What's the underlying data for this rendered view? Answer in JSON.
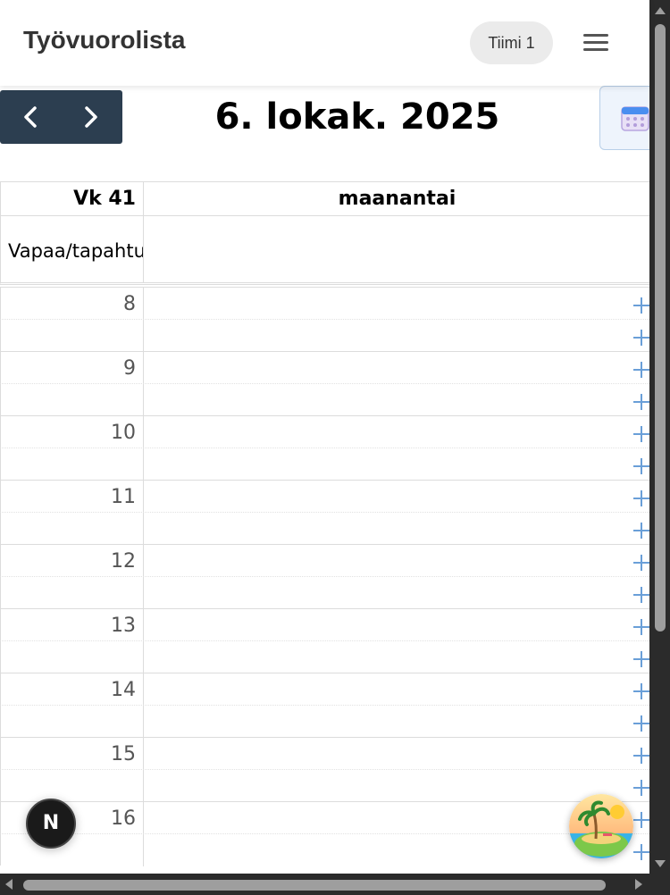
{
  "header": {
    "title": "Työvuorolista",
    "team_label": "Tiimi 1"
  },
  "toolbar": {
    "prev_icon": "chevron-left-icon",
    "next_icon": "chevron-right-icon",
    "date_title": "6. lokak. 2025",
    "calendar_icon": "calendar-icon"
  },
  "grid": {
    "week_label": "Vk 41",
    "day_label": "maanantai",
    "allday_label": "Vapaa/tapahtuma",
    "hours": [
      "8",
      "9",
      "10",
      "11",
      "12",
      "13",
      "14",
      "15",
      "16"
    ]
  },
  "overlays": {
    "next_badge": "N"
  },
  "colors": {
    "nav_bg": "#2c3e50",
    "plus_icon": "#6a9fd8",
    "scrollbar": "#2b2b2b"
  }
}
